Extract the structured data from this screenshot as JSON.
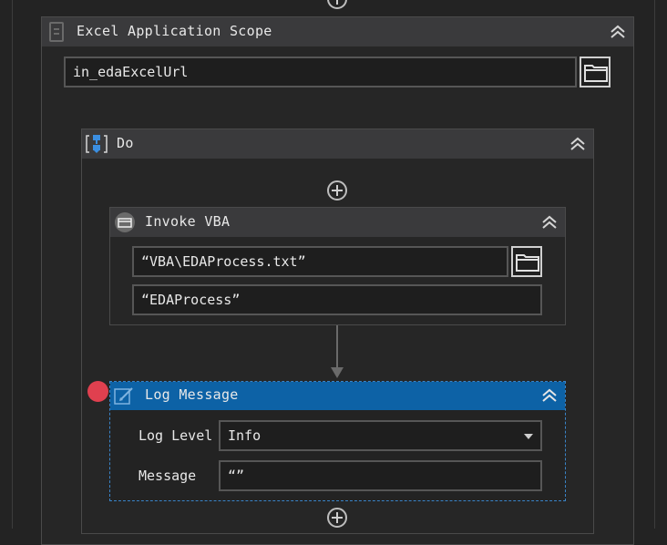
{
  "excel_scope": {
    "title": "Excel Application Scope",
    "workbook_path": "in_edaExcelUrl"
  },
  "do_sequence": {
    "title": "Do"
  },
  "invoke_vba": {
    "title": "Invoke VBA",
    "code_file_path": "“VBA\\EDAProcess.txt”",
    "entry_method": "“EDAProcess”"
  },
  "log_message": {
    "title": "Log Message",
    "log_level_label": "Log Level",
    "log_level_value": "Info",
    "message_label": "Message",
    "message_value": "“”"
  },
  "colors": {
    "selected_header": "#0d62a6",
    "breakpoint": "#e0404f"
  }
}
